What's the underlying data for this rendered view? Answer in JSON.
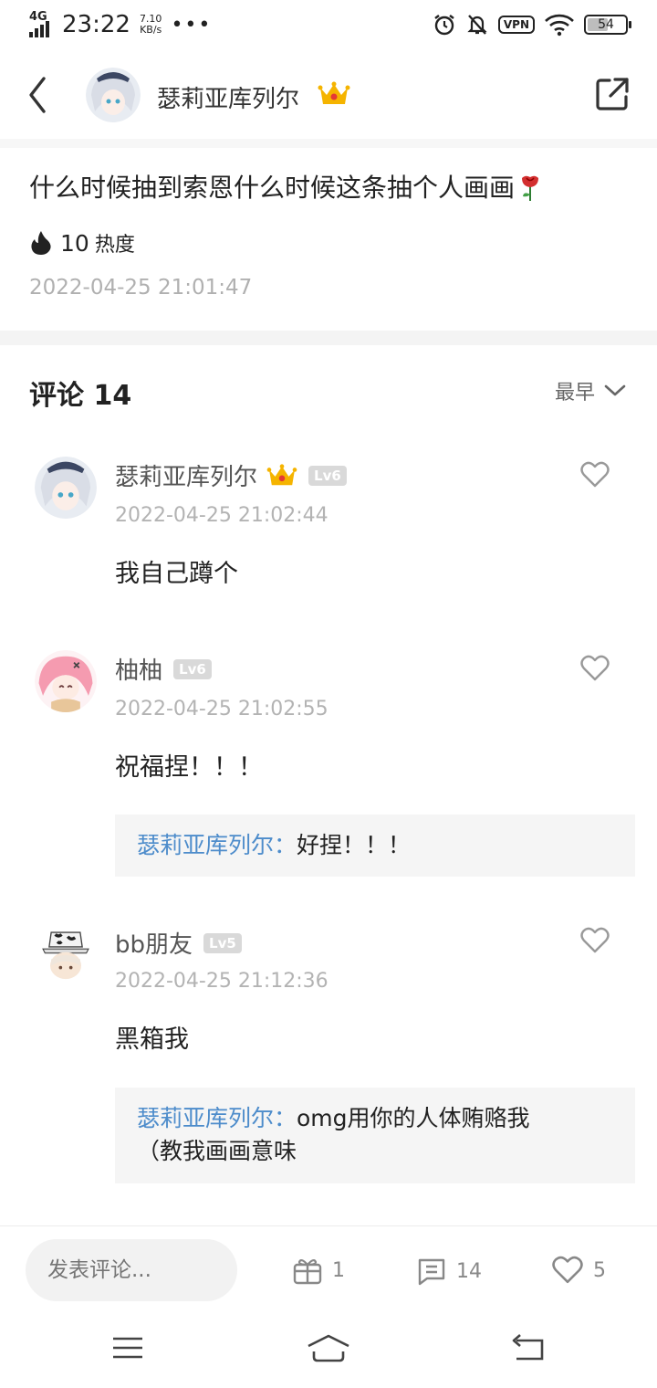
{
  "status_bar": {
    "network": "4G",
    "time": "23:22",
    "speed_value": "7.10",
    "speed_unit": "KB/s",
    "more": "•••",
    "vpn": "VPN",
    "battery": "54",
    "battery_level": 0.54
  },
  "header": {
    "author": "瑟莉亚库列尔"
  },
  "post": {
    "text": "什么时候抽到索恩什么时候这条抽个人画画",
    "heat_count": "10",
    "heat_label": "热度",
    "date": "2022-04-25 21:01:47"
  },
  "comments_section": {
    "title": "评论 14",
    "sort_label": "最早"
  },
  "comments": [
    {
      "name": "瑟莉亚库列尔",
      "level": "Lv6",
      "date": "2022-04-25 21:02:44",
      "text": "我自己蹲个"
    },
    {
      "name": "柚柚",
      "level": "Lv6",
      "date": "2022-04-25 21:02:55",
      "text": "祝福捏！！！",
      "reply_name": "瑟莉亚库列尔：",
      "reply_text": "好捏！！！"
    },
    {
      "name": "bb朋友",
      "level": "Lv5",
      "date": "2022-04-25 21:12:36",
      "text": "黑箱我",
      "reply_name": "瑟莉亚库列尔：",
      "reply_text_line1": "omg用你的人体贿赂我",
      "reply_text_line2": "（教我画画意味"
    }
  ],
  "bottom_bar": {
    "input_placeholder": "发表评论...",
    "gift_count": "1",
    "comment_count": "14",
    "like_count": "5"
  },
  "colors": {
    "accent_blue": "#4d8ccb",
    "crown_gold": "#f5b400",
    "muted": "#b3b3b3"
  }
}
